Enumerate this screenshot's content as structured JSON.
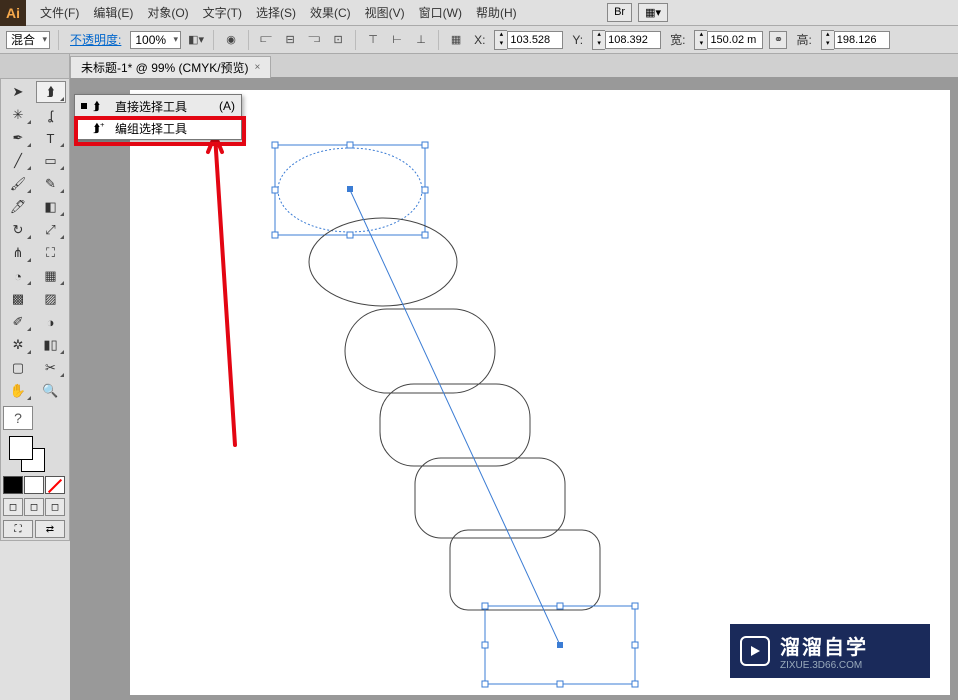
{
  "app": {
    "logo": "Ai"
  },
  "menu": {
    "file": "文件(F)",
    "edit": "编辑(E)",
    "object": "对象(O)",
    "type": "文字(T)",
    "select": "选择(S)",
    "effect": "效果(C)",
    "view": "视图(V)",
    "window": "窗口(W)",
    "help": "帮助(H)"
  },
  "menu_right": {
    "br": "Br",
    "layout_icon": "▦▾"
  },
  "optbar": {
    "blend_mode": "混合",
    "opacity_label": "不透明度:",
    "opacity_value": "100%",
    "x_label": "X:",
    "x_value": "103.528",
    "y_label": "Y:",
    "y_value": "108.392",
    "w_label": "宽:",
    "w_value": "150.02 m",
    "h_label": "高:",
    "h_value": "198.126"
  },
  "tab": {
    "title": "未标题-1* @ 99% (CMYK/预览)",
    "close": "×"
  },
  "flyout": {
    "direct": {
      "label": "直接选择工具",
      "shortcut": "(A)"
    },
    "group": {
      "label": "编组选择工具"
    }
  },
  "tool_help": "?",
  "watermark": {
    "brand": "溜溜自学",
    "url": "ZIXUE.3D66.COM"
  }
}
